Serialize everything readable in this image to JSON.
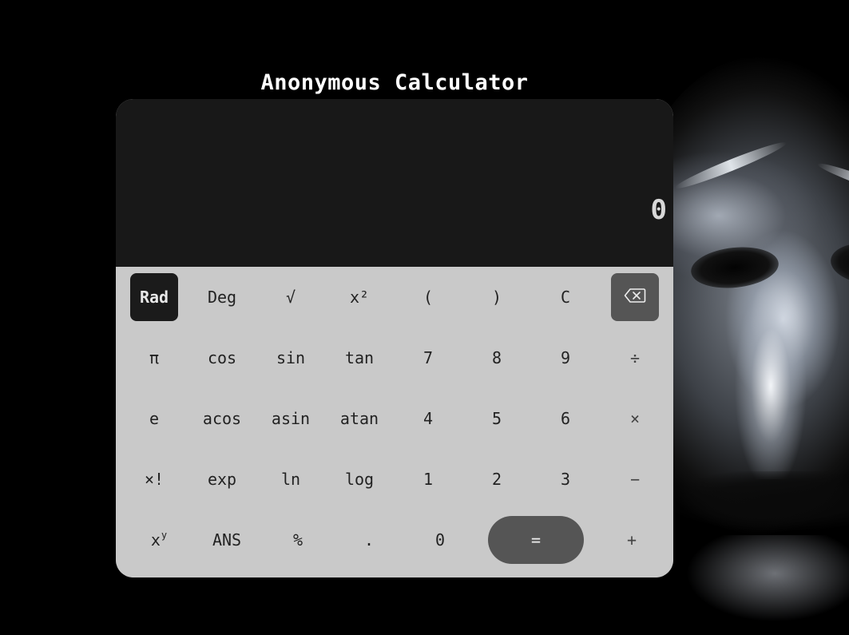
{
  "title": "Anonymous Calculator",
  "display": {
    "value": "0"
  },
  "keys": {
    "rad": "Rad",
    "deg": "Deg",
    "sqrt": "√",
    "square": "x²",
    "lparen": "(",
    "rparen": ")",
    "clear": "C",
    "backspace": "⌫",
    "pi": "π",
    "cos": "cos",
    "sin": "sin",
    "tan": "tan",
    "seven": "7",
    "eight": "8",
    "nine": "9",
    "divide": "÷",
    "e": "e",
    "acos": "acos",
    "asin": "asin",
    "atan": "atan",
    "four": "4",
    "five": "5",
    "six": "6",
    "multiply": "×",
    "factorial": "×!",
    "exp": "exp",
    "ln": "ln",
    "log": "log",
    "one": "1",
    "two": "2",
    "three": "3",
    "minus": "−",
    "power_base": "x",
    "power_sup": "y",
    "ans": "ANS",
    "percent": "%",
    "decimal": ".",
    "zero": "0",
    "equals": "=",
    "plus": "+"
  },
  "colors": {
    "background": "#000000",
    "display_bg": "#181818",
    "keypad_bg": "#c9c9c9",
    "active_key": "#1b1b1b",
    "accent_key": "#555555"
  },
  "icons": {
    "backspace": "backspace-icon"
  }
}
